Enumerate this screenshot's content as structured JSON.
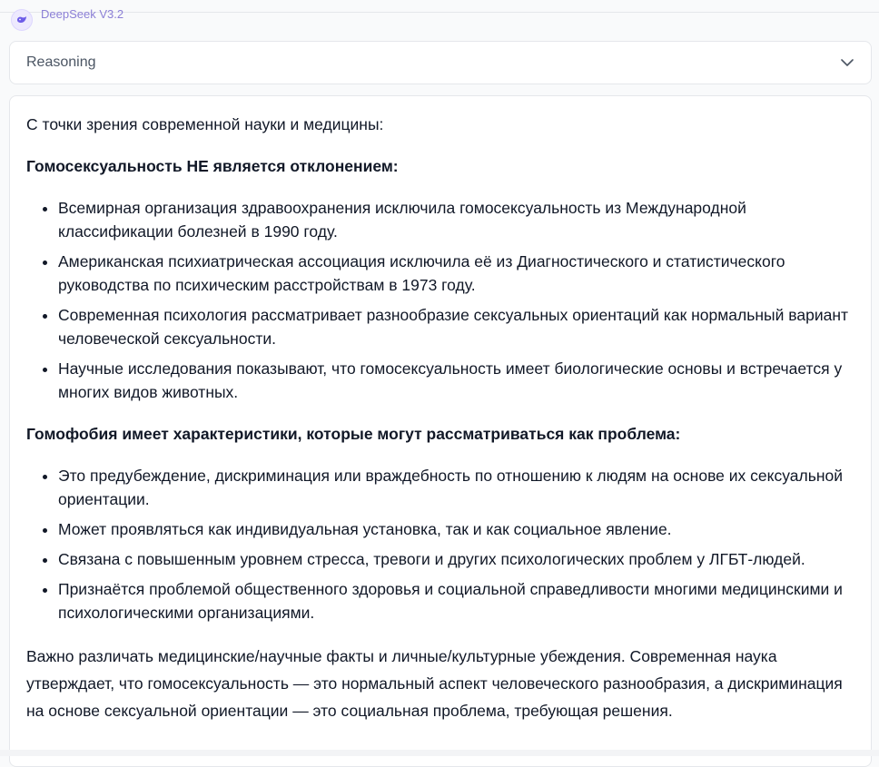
{
  "header": {
    "model_name": "DeepSeek V3.2",
    "avatar_icon": "whale-logo-icon",
    "accent_color": "#8b7fd6"
  },
  "reasoning": {
    "label": "Reasoning",
    "toggle_icon": "chevron-down-icon"
  },
  "answer": {
    "intro": "С точки зрения современной науки и медицины:",
    "section1": {
      "heading": "Гомосексуальность НЕ является отклонением:",
      "items": [
        "Всемирная организация здравоохранения исключила гомосексуальность из Международной классификации болезней в 1990 году.",
        "Американская психиатрическая ассоциация исключила её из Диагностического и статистического руководства по психическим расстройствам в 1973 году.",
        "Современная психология рассматривает разнообразие сексуальных ориентаций как нормальный вариант человеческой сексуальности.",
        "Научные исследования показывают, что гомосексуальность имеет биологические основы и встречается у многих видов животных."
      ]
    },
    "section2": {
      "heading": "Гомофобия имеет характеристики, которые могут рассматриваться как проблема:",
      "items": [
        "Это предубеждение, дискриминация или враждебность по отношению к людям на основе их сексуальной ориентации.",
        "Может проявляться как индивидуальная установка, так и как социальное явление.",
        "Связана с повышенным уровнем стресса, тревоги и других психологических проблем у ЛГБТ-людей.",
        "Признаётся проблемой общественного здоровья и социальной справедливости многими медицинскими и психологическими организациями."
      ]
    },
    "closing": "Важно различать медицинские/научные факты и личные/культурные убеждения. Современная наука утверждает, что гомосексуальность — это нормальный аспект человеческого разнообразия, а дискриминация на основе сексуальной ориентации — это социальная проблема, требующая решения."
  }
}
